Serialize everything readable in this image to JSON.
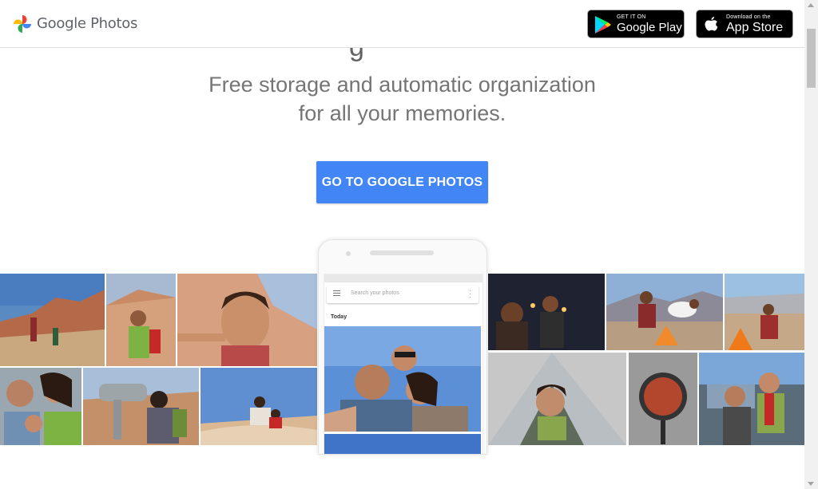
{
  "header": {
    "brand": "Google Photos",
    "google_play": {
      "small": "GET IT ON",
      "big": "Google Play"
    },
    "app_store": {
      "small": "Download on the",
      "big": "App Store"
    }
  },
  "hero": {
    "headline_fragment": "g",
    "tagline_line1": "Free storage and automatic organization",
    "tagline_line2": "for all your memories.",
    "cta_label": "GO TO GOOGLE PHOTOS"
  },
  "phone": {
    "search_placeholder": "Search your photos",
    "section_label": "Today"
  },
  "colors": {
    "cta": "#4285f4",
    "tagline": "#757575"
  }
}
